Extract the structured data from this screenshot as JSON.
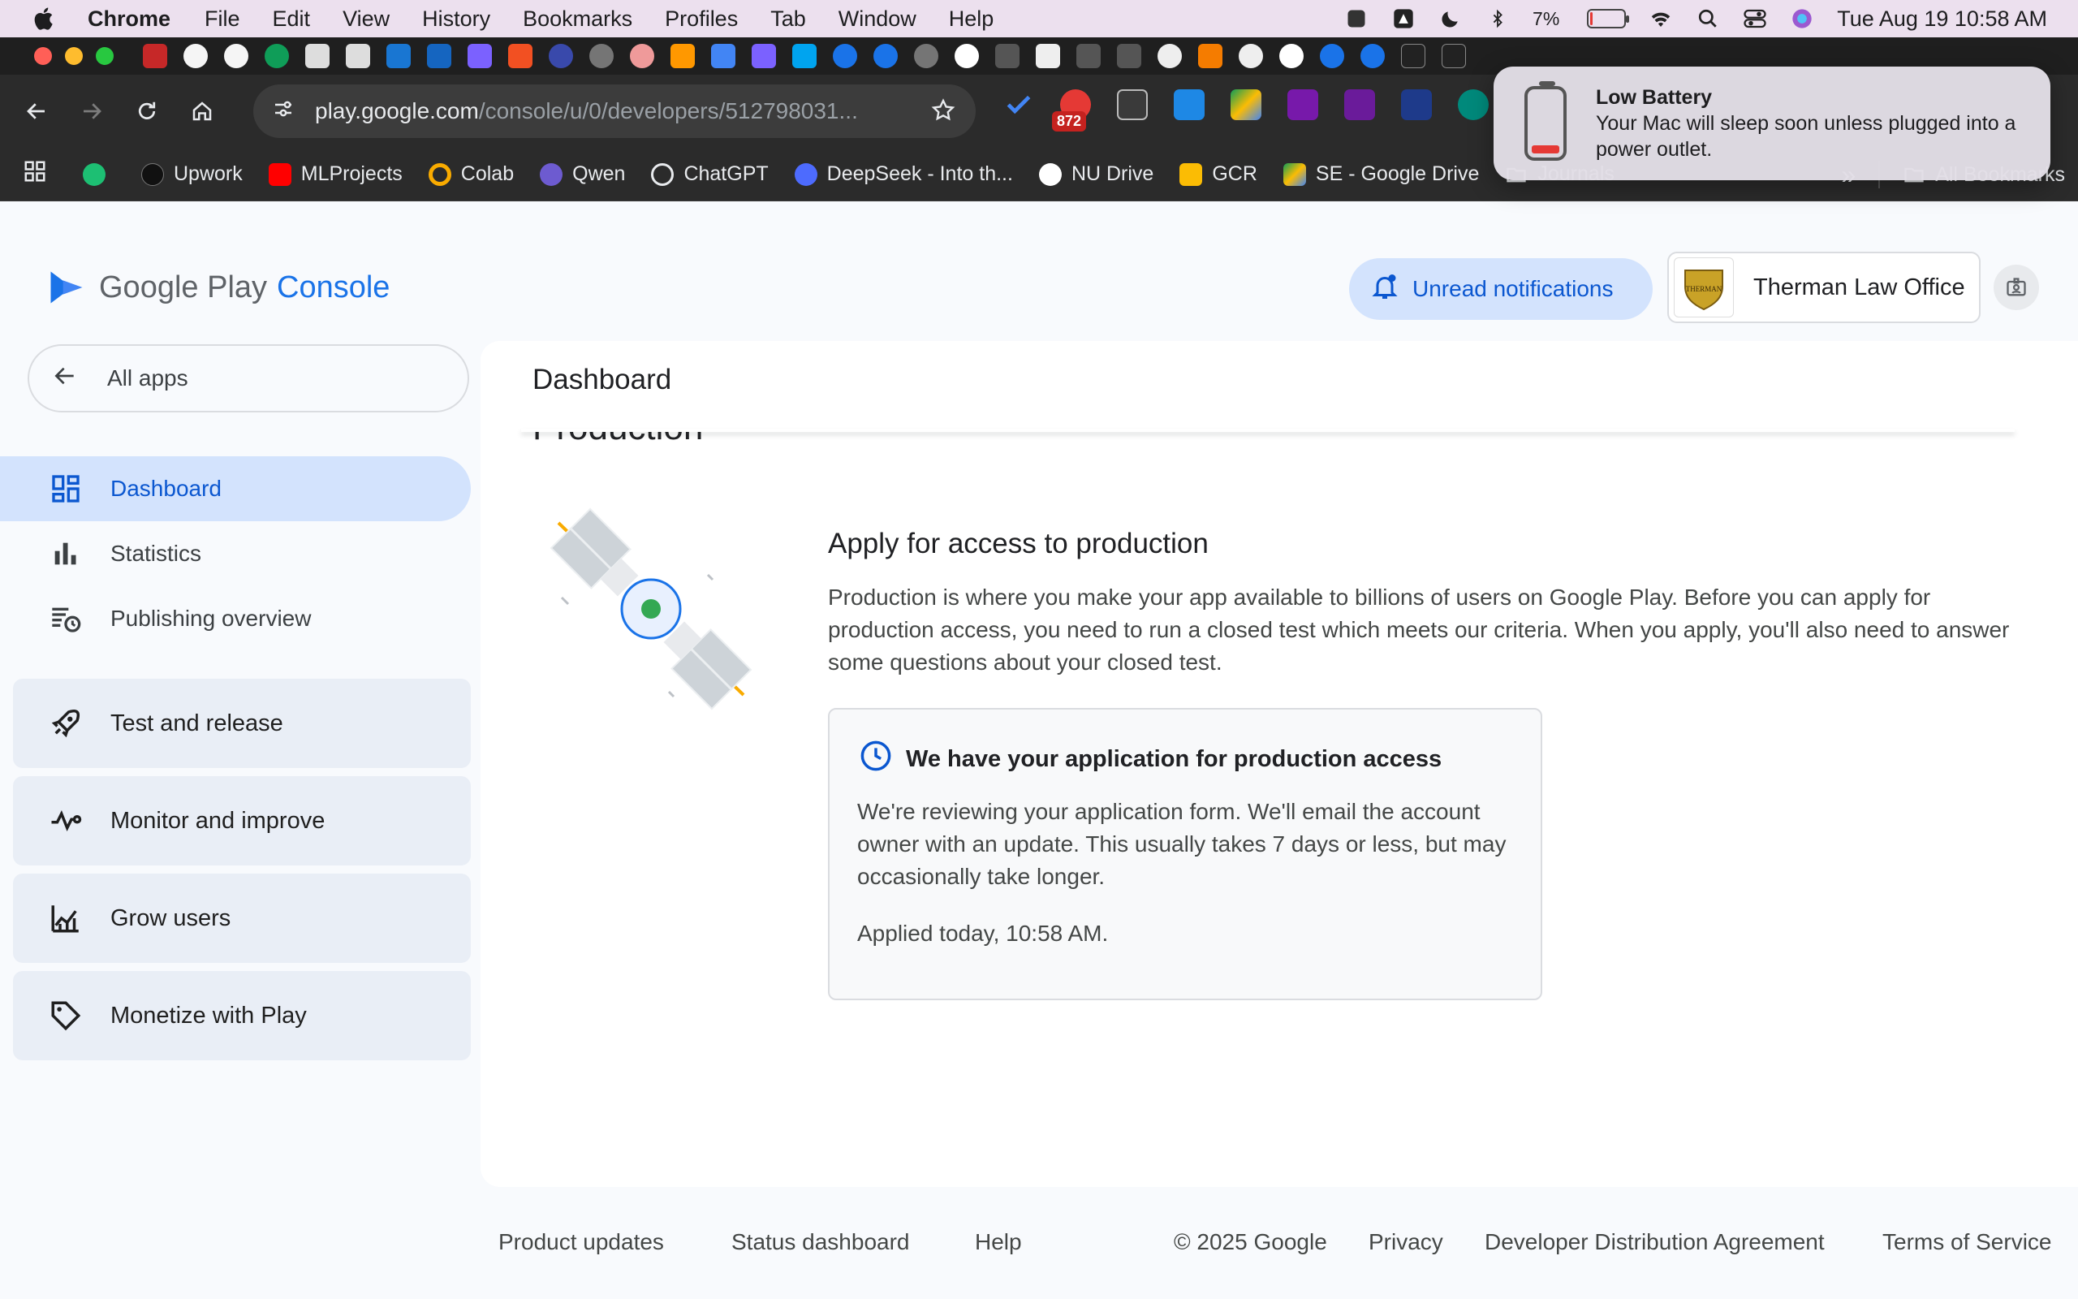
{
  "menubar": {
    "app_name": "Chrome",
    "items": [
      "File",
      "Edit",
      "View",
      "History",
      "Bookmarks",
      "Profiles",
      "Tab",
      "Window",
      "Help"
    ],
    "battery_percent": "7%",
    "battery_level": 0.07,
    "datetime": "Tue Aug 19  10:58 AM"
  },
  "browser": {
    "url_host": "play.google.com",
    "url_path": "/console/u/0/developers/512798031...",
    "extension_badge": "872"
  },
  "bookmarks": {
    "items": [
      "Upwork",
      "MLProjects",
      "Colab",
      "Qwen",
      "ChatGPT",
      "DeepSeek - Into th...",
      "NU Drive",
      "GCR",
      "SE - Google Drive",
      "Journals"
    ],
    "more": "»",
    "all_bookmarks": "All Bookmarks"
  },
  "notification": {
    "title": "Low Battery",
    "body": "Your Mac will sleep soon unless plugged into a power outlet."
  },
  "header": {
    "logo_text": "Google Play",
    "logo_console": "Console",
    "notifications_button": "Unread notifications",
    "account_name": "Therman Law Office",
    "avatar_text": "THERMAN"
  },
  "sidebar": {
    "all_apps": "All apps",
    "items": [
      {
        "label": "Dashboard",
        "icon": "dashboard-icon",
        "active": true
      },
      {
        "label": "Statistics",
        "icon": "bar-chart-icon"
      },
      {
        "label": "Publishing overview",
        "icon": "publishing-icon"
      }
    ],
    "groups": [
      {
        "label": "Test and release",
        "icon": "rocket-icon"
      },
      {
        "label": "Monitor and improve",
        "icon": "pulse-icon"
      },
      {
        "label": "Grow users",
        "icon": "growth-chart-icon"
      },
      {
        "label": "Monetize with Play",
        "icon": "tag-icon"
      }
    ]
  },
  "main": {
    "page_title": "Dashboard",
    "section_title": "Production",
    "apply_title": "Apply for access to production",
    "apply_description": "Production is where you make your app available to billions of users on Google Play. Before you can apply for production access, you need to run a closed test which meets our criteria. When you apply, you'll also need to answer some questions about your closed test.",
    "status_card": {
      "title": "We have your application for production access",
      "body": "We're reviewing your application form. We'll email the account owner with an update. This usually takes 7 days or less, but may occasionally take longer.",
      "applied": "Applied today, 10:58 AM."
    }
  },
  "footer": {
    "links": [
      "Product updates",
      "Status dashboard",
      "Help"
    ],
    "copyright": "© 2025 Google",
    "right_links": [
      "Privacy",
      "Developer Distribution Agreement",
      "Terms of Service"
    ]
  },
  "colors": {
    "accent": "#0b57d0",
    "active_nav_bg": "#d3e3fd",
    "group_bg": "#e9eef6",
    "status_green": "#34a853"
  }
}
